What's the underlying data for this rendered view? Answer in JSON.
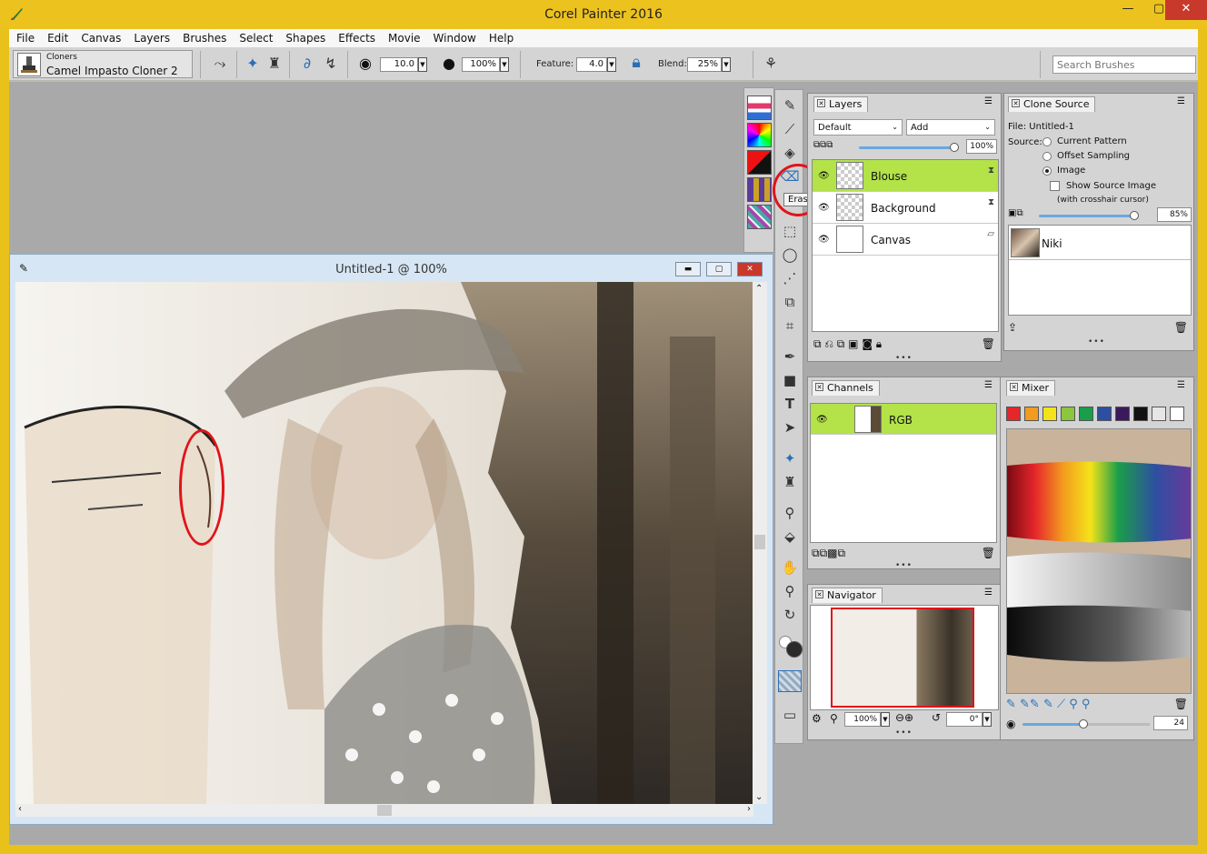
{
  "app": {
    "title": "Corel Painter 2016",
    "window_controls": {
      "minimize": "—",
      "maximize": "▢",
      "close": "✕"
    }
  },
  "menu": [
    "File",
    "Edit",
    "Canvas",
    "Layers",
    "Brushes",
    "Select",
    "Shapes",
    "Effects",
    "Movie",
    "Window",
    "Help"
  ],
  "property_bar": {
    "brush_category": "Cloners",
    "brush_variant": "Camel Impasto Cloner 2",
    "size_value": "10.0",
    "opacity_value": "100%",
    "feature_label": "Feature:",
    "feature_value": "4.0",
    "blend_label": "Blend:",
    "blend_value": "25%",
    "search_placeholder": "Search Brushes"
  },
  "toolbox": {
    "tooltip": "Eraser",
    "tools": [
      "brush-tool-icon",
      "dropper-icon",
      "paint-bucket-icon",
      "eraser-icon",
      "layer-adjuster-icon",
      "rect-select-icon",
      "lasso-icon",
      "magic-wand-icon",
      "transform-icon",
      "crop-icon",
      "pen-icon",
      "rectangle-shape-icon",
      "text-icon",
      "shape-selection-icon",
      "cloner-tool-icon",
      "rubber-stamp-icon",
      "dodge-icon",
      "burn-icon",
      "grabber-icon",
      "magnifier-icon",
      "rotate-page-icon"
    ]
  },
  "document": {
    "title": "Untitled-1 @ 100%"
  },
  "layers_panel": {
    "tab": "Layers",
    "composite_method": "Default",
    "composite_depth": "Add",
    "opacity": "100%",
    "layers": [
      {
        "name": "Blouse",
        "selected": true
      },
      {
        "name": "Background",
        "selected": false
      },
      {
        "name": "Canvas",
        "selected": false
      }
    ]
  },
  "clone_source_panel": {
    "tab": "Clone Source",
    "file_label": "File: Untitled-1",
    "source_label": "Source:",
    "options": [
      "Current Pattern",
      "Offset Sampling",
      "Image"
    ],
    "selected_option": "Image",
    "show_source_label": "Show Source Image",
    "crosshair_label": "(with crosshair cursor)",
    "opacity": "85%",
    "source_item": "Niki"
  },
  "channels_panel": {
    "tab": "Channels",
    "channel": "RGB"
  },
  "mixer_panel": {
    "tab": "Mixer",
    "swatches": [
      "#e5262b",
      "#f39a1f",
      "#f4e31a",
      "#8cc63f",
      "#1a9e4a",
      "#2e4fa1",
      "#3a1a5c",
      "#111111",
      "#e6e6e6",
      "#ffffff"
    ],
    "brush_size": "24"
  },
  "navigator_panel": {
    "tab": "Navigator",
    "zoom": "100%",
    "rotation": "0°"
  },
  "colors": {
    "accent_selection": "#b3e249",
    "annotation_red": "#e0141a",
    "title_bar": "#ecc21e"
  }
}
